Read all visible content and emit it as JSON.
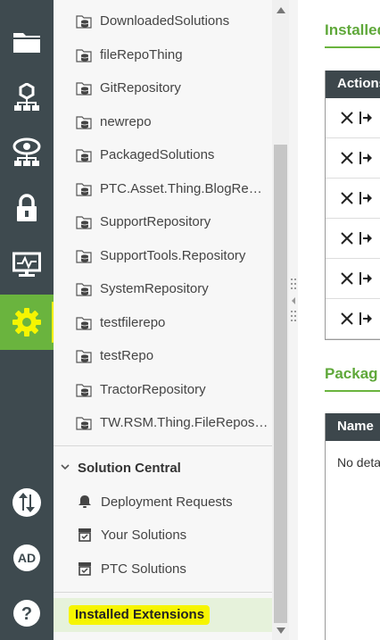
{
  "rail": {
    "items": [
      {
        "icon": "folder-icon"
      },
      {
        "icon": "hierarchy-icon"
      },
      {
        "icon": "monitor-eye-icon"
      },
      {
        "icon": "lock-icon"
      },
      {
        "icon": "activity-monitor-icon"
      },
      {
        "icon": "gear-icon",
        "active": true
      },
      {
        "icon": "import-export-icon"
      },
      {
        "icon": "user-avatar-icon",
        "text": "AD"
      },
      {
        "icon": "help-icon"
      }
    ]
  },
  "tree": {
    "repositories": [
      "DownloadedSolutions",
      "fileRepoThing",
      "GitRepository",
      "newrepo",
      "PackagedSolutions",
      "PTC.Asset.Thing.BlogRep…",
      "SupportRepository",
      "SupportTools.Repository",
      "SystemRepository",
      "testfilerepo",
      "testRepo",
      "TractorRepository",
      "TW.RSM.Thing.FileRepos…"
    ],
    "solution_central": {
      "label": "Solution Central",
      "items": [
        {
          "label": "Deployment Requests",
          "icon": "bell-icon"
        },
        {
          "label": "Your Solutions",
          "icon": "solution-box-icon"
        },
        {
          "label": "PTC Solutions",
          "icon": "solution-box-icon"
        }
      ]
    },
    "selected": "Installed Extensions"
  },
  "main": {
    "installed_title": "Installed",
    "actions_header": "Actions",
    "packages_title": "Packag",
    "name_header": "Name",
    "empty_text": "No deta"
  },
  "colors": {
    "rail_bg": "#3e4a4f",
    "accent_green": "#6ab43e",
    "highlight_yellow": "#f3f100",
    "table_header_bg": "#3d474c"
  }
}
